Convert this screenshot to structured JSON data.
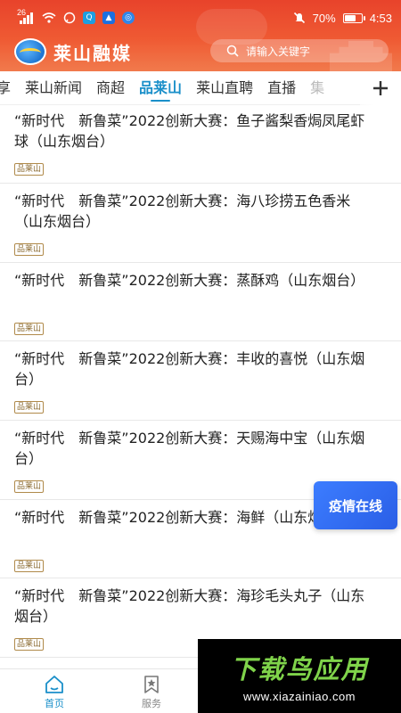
{
  "status_bar": {
    "network": "26",
    "battery": "70%",
    "battery_level": 0.7,
    "time": "4:53"
  },
  "header": {
    "brand_name": "莱山融媒",
    "search_placeholder": "请输入关键字",
    "colors": {
      "gradient_top": "#e8432b",
      "gradient_bottom": "#f17a4c"
    }
  },
  "tabs": [
    {
      "label": "享",
      "active": false
    },
    {
      "label": "莱山新闻",
      "active": false
    },
    {
      "label": "商超",
      "active": false
    },
    {
      "label": "品莱山",
      "active": true
    },
    {
      "label": "莱山直聘",
      "active": false
    },
    {
      "label": "直播",
      "active": false
    },
    {
      "label": "集",
      "active": false
    }
  ],
  "accent_color": "#1a8fc9",
  "news": [
    {
      "title": "“新时代　新鲁菜”2022创新大赛：鱼子酱梨香焗凤尾虾球（山东烟台）",
      "tag": "品莱山"
    },
    {
      "title": "“新时代　新鲁菜”2022创新大赛：海八珍捞五色香米（山东烟台）",
      "tag": "品莱山"
    },
    {
      "title": "“新时代　新鲁菜”2022创新大赛：蒸酥鸡（山东烟台）",
      "tag": "品莱山"
    },
    {
      "title": "“新时代　新鲁菜”2022创新大赛：丰收的喜悦（山东烟台）",
      "tag": "品莱山"
    },
    {
      "title": "“新时代　新鲁菜”2022创新大赛：天赐海中宝（山东烟台）",
      "tag": "品莱山"
    },
    {
      "title": "“新时代　新鲁菜”2022创新大赛：海鲜（山东烟台）",
      "tag": "品莱山"
    },
    {
      "title": "“新时代　新鲁菜”2022创新大赛：海珍毛头丸子（山东烟台）",
      "tag": "品莱山"
    }
  ],
  "floating_badge": {
    "label": "疫情在线"
  },
  "bottom_nav": {
    "home_label": "首页",
    "service_label": "服务"
  },
  "watermark": {
    "title": "下载鸟应用",
    "url": "www.xiazainiao.com"
  }
}
